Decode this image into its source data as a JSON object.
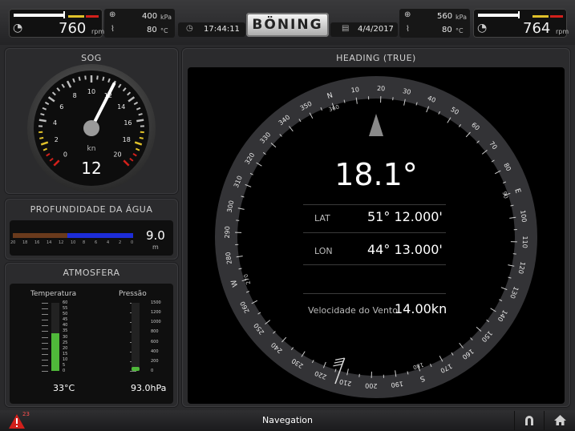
{
  "top": {
    "left_engine": {
      "rpm": "760",
      "rpm_unit": "rpm",
      "pressure": "400",
      "pressure_unit": "kPa",
      "temp": "80",
      "temp_unit": "°C"
    },
    "right_engine": {
      "rpm": "764",
      "rpm_unit": "rpm",
      "pressure": "560",
      "pressure_unit": "kPa",
      "temp": "80",
      "temp_unit": "°C"
    },
    "time": "17:44:11",
    "date": "4/4/2017",
    "brand": "BÖNING"
  },
  "sog": {
    "title": "SOG",
    "value": "12",
    "unit": "kn",
    "ticks": [
      "0",
      "2",
      "4",
      "6",
      "8",
      "10",
      "12",
      "14",
      "16",
      "18",
      "20"
    ],
    "needle_value": 12,
    "max": 20
  },
  "depth": {
    "title": "PROFUNDIDADE DA ÁGUA",
    "value": "9.0",
    "unit": "m",
    "scale": [
      "20",
      "18",
      "16",
      "14",
      "12",
      "10",
      "8",
      "6",
      "4",
      "2",
      "0"
    ],
    "level_fraction": 0.45
  },
  "atmos": {
    "title": "ATMOSFERA",
    "temp_label": "Temperatura",
    "temp_scale": [
      "60",
      "55",
      "50",
      "45",
      "40",
      "35",
      "30",
      "25",
      "20",
      "15",
      "10",
      "5",
      "0"
    ],
    "temp_value": "33°C",
    "temp_fraction": 0.55,
    "press_label": "Pressão",
    "press_scale": [
      "1500",
      "1200",
      "1000",
      "800",
      "600",
      "400",
      "200",
      "0"
    ],
    "press_value": "93.0hPa",
    "press_fraction": 0.06
  },
  "heading": {
    "title": "HEADING (TRUE)",
    "value": "18.1°",
    "lat_label": "LAT",
    "lat_value": "51° 12.000'",
    "lon_label": "LON",
    "lon_value": "44° 13.000'",
    "wind_label": "Velocidade do Vento",
    "wind_value": "14.00kn",
    "heading_deg": 18.1,
    "compass_labels": [
      "N",
      "10",
      "20",
      "30",
      "40",
      "50",
      "60",
      "70",
      "80",
      "E",
      "100",
      "110",
      "120",
      "130",
      "140",
      "150",
      "160",
      "170",
      "S",
      "190",
      "200",
      "210",
      "220",
      "230",
      "240",
      "250",
      "260",
      "W",
      "280",
      "290",
      "300",
      "310",
      "320",
      "330",
      "340",
      "350"
    ],
    "extra_labels": [
      "180",
      "90",
      "270",
      "360"
    ]
  },
  "bottom": {
    "title": "Navegation",
    "alarm_count": "23"
  },
  "colors": {
    "accent": "#e0c12a",
    "red": "#d2201b",
    "green": "#4fb83a",
    "blue": "#1d2dd8",
    "brown": "#6a3a1c"
  }
}
